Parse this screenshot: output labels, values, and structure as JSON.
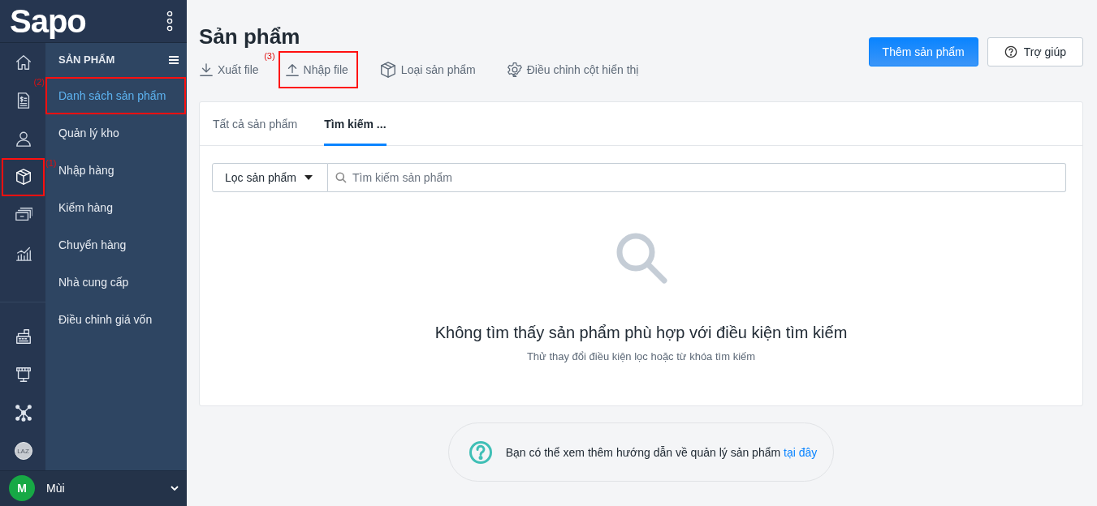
{
  "brand": {
    "logo": "Sapo"
  },
  "rail": [
    {
      "selected": false
    },
    {
      "selected": false
    },
    {
      "selected": false
    },
    {
      "selected": true,
      "callout": "(1)"
    },
    {
      "selected": false
    },
    {
      "selected": false
    }
  ],
  "rail_badge": "LAZ",
  "submenu": {
    "title": "SẢN PHẨM",
    "items": [
      {
        "label": "Danh sách sản phẩm",
        "selected": true,
        "callout": "(2)"
      },
      {
        "label": "Quản lý kho",
        "selected": false
      },
      {
        "label": "Nhập hàng",
        "selected": false
      },
      {
        "label": "Kiểm hàng",
        "selected": false
      },
      {
        "label": "Chuyển hàng",
        "selected": false
      },
      {
        "label": "Nhà cung cấp",
        "selected": false
      },
      {
        "label": "Điều chỉnh giá vốn",
        "selected": false
      }
    ]
  },
  "user": {
    "initial": "M",
    "name": "Mùi"
  },
  "page": {
    "title": "Sản phẩm",
    "actions": [
      {
        "label": "Xuất file"
      },
      {
        "label": "Nhập file",
        "callout": "(3)"
      },
      {
        "label": "Loại sản phẩm"
      },
      {
        "label": "Điều chỉnh cột hiển thị"
      }
    ],
    "primary_button": "Thêm sản phẩm",
    "help_button": "Trợ giúp"
  },
  "tabs": [
    {
      "label": "Tất cả sản phẩm",
      "selected": false
    },
    {
      "label": "Tìm kiếm ...",
      "selected": true
    }
  ],
  "filter": {
    "dropdown": "Lọc sản phẩm",
    "search": {
      "placeholder": "Tìm kiếm sản phẩm"
    }
  },
  "empty": {
    "title": "Không tìm thấy sản phẩm phù hợp với điều kiện tìm kiếm",
    "subtitle": "Thử thay đổi điều kiện lọc hoặc từ khóa tìm kiếm"
  },
  "help_note": {
    "text": "Bạn có thể xem thêm hướng dẫn về quản lý sản phẩm",
    "link": "tại đây"
  }
}
